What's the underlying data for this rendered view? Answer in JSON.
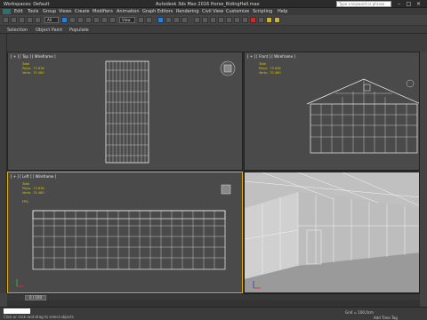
{
  "titlebar": {
    "workspace": "Workspaces: Default",
    "title": "Autodesk 3ds Max 2016    Horse_RidingHall.max",
    "search_placeholder": "Type a keyword or phrase"
  },
  "menubar": {
    "items": [
      "Edit",
      "Tools",
      "Group",
      "Views",
      "Create",
      "Modifiers",
      "Animation",
      "Graph Editors",
      "Rendering",
      "Civil View",
      "Customize",
      "Scripting",
      "Help"
    ]
  },
  "toolbar": {
    "selection_filter": "All",
    "ref_coord": "View"
  },
  "ribbon": {
    "items": [
      "Selection",
      "Object Paint",
      "Populate"
    ]
  },
  "viewports": {
    "top": {
      "label": "[ + ] [ Top ] [ Wireframe ]",
      "stats": "Total\nPolys:  73 836\nVerts:  70 480"
    },
    "front": {
      "label": "[ + ] [ Front ] [ Wireframe ]",
      "stats": "Total\nPolys:  73 836\nVerts:  70 480"
    },
    "left": {
      "label": "[ + ] [ Left ] [ Wireframe ]",
      "stats": "Total\nPolys:  73 836\nVerts:  70 480\n\nFPS:"
    },
    "persp": {
      "label": ""
    }
  },
  "timeline": {
    "frame": "0 / 100"
  },
  "status": {
    "message": "Click or click-and-drag to select objects",
    "grid": "Grid = 100,0cm",
    "add_time_tag": "Add Time Tag"
  },
  "colors": {
    "active_viewport": "#e0b000",
    "stats": "#d9c500"
  }
}
